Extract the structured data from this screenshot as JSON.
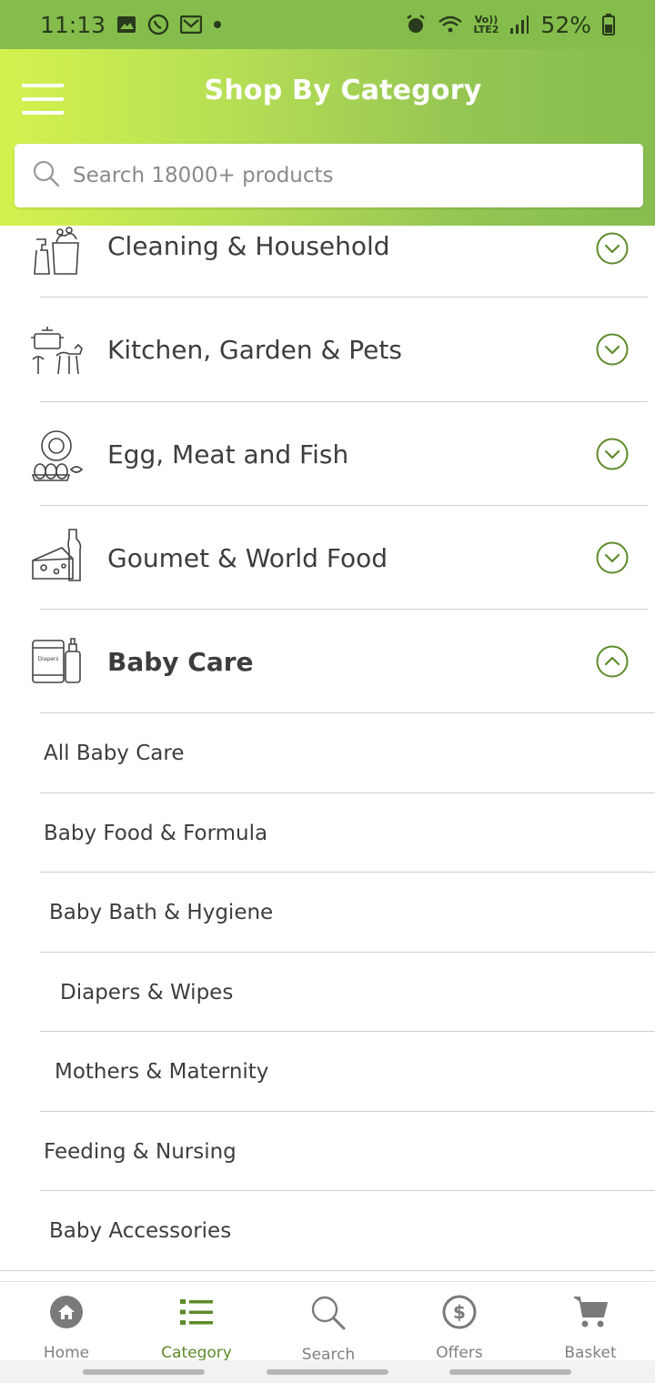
{
  "status_bar": {
    "time": "11:13",
    "battery": "52%",
    "network": "LTE2"
  },
  "header": {
    "title": "Shop By Category",
    "search_placeholder": "Search 18000+ products"
  },
  "categories": [
    {
      "label": "Cleaning & Household",
      "icon": "cleaning-icon",
      "expanded": false
    },
    {
      "label": "Kitchen, Garden & Pets",
      "icon": "kitchen-pets-icon",
      "expanded": false
    },
    {
      "label": "Egg, Meat and Fish",
      "icon": "egg-meat-icon",
      "expanded": false
    },
    {
      "label": "Goumet & World Food",
      "icon": "gourmet-icon",
      "expanded": false
    },
    {
      "label": "Baby Care",
      "icon": "baby-care-icon",
      "icon_text": "Diapers",
      "expanded": true
    }
  ],
  "subcategories": [
    {
      "label": "All Baby Care"
    },
    {
      "label": "Baby Food & Formula"
    },
    {
      "label": "Baby Bath & Hygiene"
    },
    {
      "label": "Diapers & Wipes"
    },
    {
      "label": "Mothers & Maternity"
    },
    {
      "label": "Feeding & Nursing"
    },
    {
      "label": "Baby Accessories"
    }
  ],
  "bottom_nav": [
    {
      "label": "Home",
      "icon": "home-icon",
      "active": false
    },
    {
      "label": "Category",
      "icon": "list-icon",
      "active": true
    },
    {
      "label": "Search",
      "icon": "search-icon",
      "active": false
    },
    {
      "label": "Offers",
      "icon": "offers-icon",
      "active": false
    },
    {
      "label": "Basket",
      "icon": "cart-icon",
      "active": false
    }
  ],
  "colors": {
    "accent_green": "#5e8a2a",
    "header_start": "#d4f24e",
    "header_end": "#86bd4d",
    "status_bar": "#84bd4c"
  }
}
